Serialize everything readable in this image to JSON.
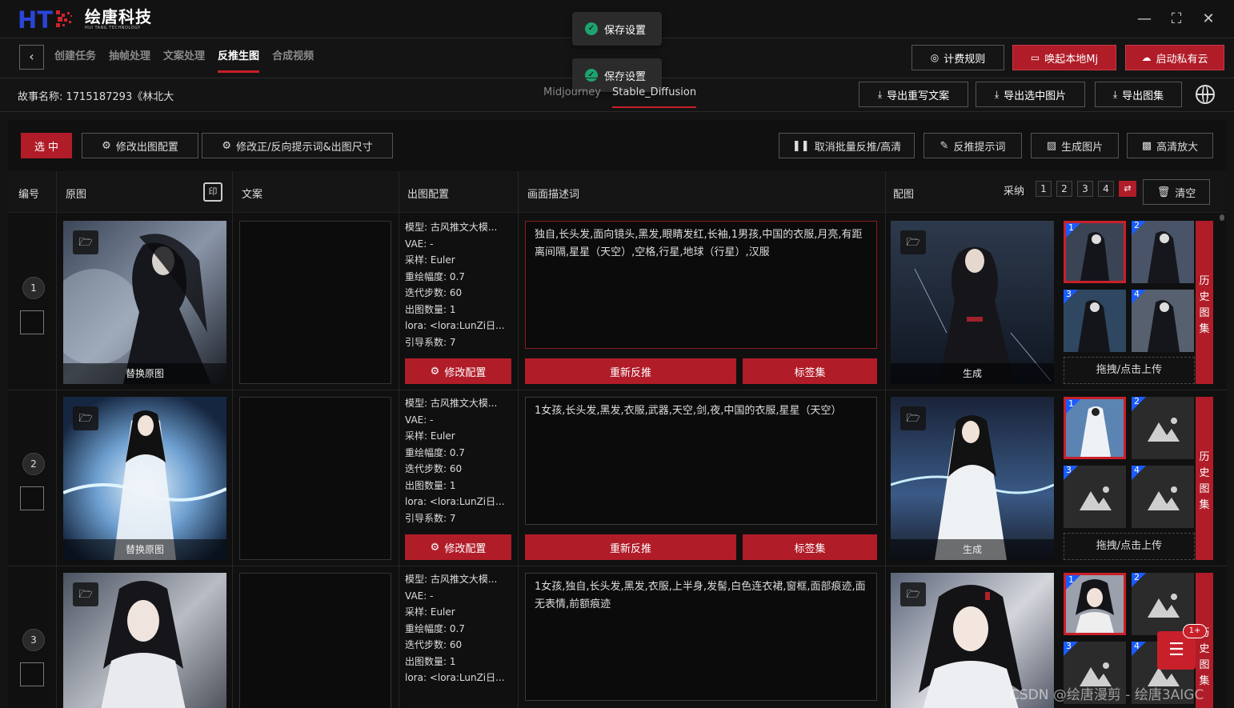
{
  "app": {
    "logo_cn": "绘唐科技",
    "logo_en": "HUI TANG TECHNOLOGY",
    "logo_mark": "HT"
  },
  "toasts": [
    "保存设置",
    "保存设置"
  ],
  "nav": {
    "tabs": [
      "创建任务",
      "抽帧处理",
      "文案处理",
      "反推生图",
      "合成视频"
    ],
    "active_tab": "反推生图",
    "buttons": {
      "billing": "计费规则",
      "local_mj": "唤起本地Mj",
      "private_cloud": "启动私有云"
    }
  },
  "story": {
    "label": "故事名称:  1715187293《林北大",
    "model_tabs": [
      "Midjourney",
      "Stable_Diffusion"
    ],
    "active_model": "Stable_Diffusion",
    "export_buttons": [
      "导出重写文案",
      "导出选中图片",
      "导出图集"
    ]
  },
  "toolbar": {
    "select": "选 中",
    "edit_config": "修改出图配置",
    "edit_prompt": "修改正/反向提示词&出图尺寸",
    "cancel_batch": "取消批量反推/高清",
    "reverse_prompt": "反推提示词",
    "generate": "生成图片",
    "upscale": "高清放大"
  },
  "columns": {
    "num": "编号",
    "original": "原图",
    "copy": "文案",
    "config": "出图配置",
    "desc": "画面描述词",
    "match": "配图",
    "adopt": "采纳",
    "adopt_options": [
      "1",
      "2",
      "3",
      "4"
    ],
    "clear": "清空"
  },
  "row_labels": {
    "replace": "替换原图",
    "edit_cfg": "修改配置",
    "re_reverse": "重新反推",
    "tags": "标签集",
    "generate": "生成",
    "upload": "拖拽/点击上传",
    "history": "历史图集"
  },
  "rows": [
    {
      "index": "1",
      "config": [
        "模型:  古风推文大模...",
        "VAE:  -",
        "采样:  Euler",
        "重绘幅度:  0.7",
        "迭代步数:  60",
        "出图数量:  1",
        "lora:  <lora:LunZi日...",
        "引导系数:  7"
      ],
      "desc": "独自,长头发,面向镜头,黑发,眼睛发红,长袖,1男孩,中国的衣服,月亮,有距离间隔,星星（天空）,空格,行星,地球（行星）,汉服",
      "thumb_nums": [
        "1",
        "2",
        "3",
        "4"
      ]
    },
    {
      "index": "2",
      "config": [
        "模型:  古风推文大模...",
        "VAE:  -",
        "采样:  Euler",
        "重绘幅度:  0.7",
        "迭代步数:  60",
        "出图数量:  1",
        "lora:  <lora:LunZi日...",
        "引导系数:  7"
      ],
      "desc": "1女孩,长头发,黑发,衣服,武器,天空,剑,夜,中国的衣服,星星（天空）",
      "thumb_nums": [
        "1",
        "2",
        "3",
        "4"
      ]
    },
    {
      "index": "3",
      "config": [
        "模型:  古风推文大模...",
        "VAE:  -",
        "采样:  Euler",
        "重绘幅度:  0.7",
        "迭代步数:  60",
        "出图数量:  1",
        "lora:  <lora:LunZi日..."
      ],
      "desc": "1女孩,独自,长头发,黑发,衣服,上半身,发髻,白色连衣裙,窗框,面部痕迹,面无表情,前额痕迹",
      "thumb_nums": [
        "1",
        "2",
        "3",
        "4"
      ]
    }
  ],
  "fab_badge": "1+",
  "watermark": "CSDN @绘唐漫剪 - 绘唐3AIGC",
  "colors": {
    "accent": "#b01c28",
    "bg": "#141414",
    "badge_blue": "#1a5cff",
    "toast_ok": "#1ea36d"
  },
  "icons": [
    "back-icon",
    "gear-icon",
    "pause-icon",
    "edit-icon",
    "image-icon",
    "upscale-icon",
    "trash-icon",
    "folder-icon",
    "globe-icon",
    "download-icon",
    "coin-icon",
    "monitor-icon",
    "cloud-icon",
    "list-icon"
  ]
}
